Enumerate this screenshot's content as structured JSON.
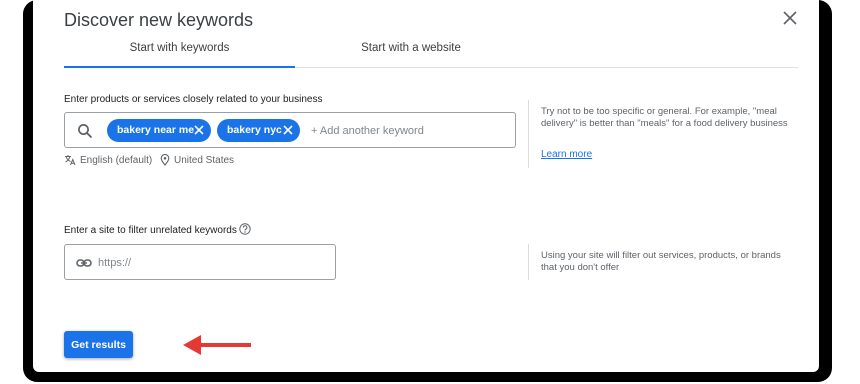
{
  "dialog": {
    "title": "Discover new keywords",
    "close_icon": "close-icon"
  },
  "tabs": [
    {
      "label": "Start with keywords",
      "active": true
    },
    {
      "label": "Start with a website",
      "active": false
    }
  ],
  "keywords_section": {
    "label": "Enter products or services closely related to your business",
    "chips": [
      {
        "label": "bakery near me"
      },
      {
        "label": "bakery nyc"
      }
    ],
    "input_placeholder": "+ Add another keyword",
    "input_value": "",
    "language": "English (default)",
    "location": "United States",
    "hint": "Try not to be too specific or general. For example, \"meal delivery\" is better than \"meals\" for a food delivery business",
    "learn_more": "Learn more"
  },
  "site_section": {
    "label": "Enter a site to filter unrelated keywords",
    "input_placeholder": "https://",
    "input_value": "",
    "hint": "Using your site will filter out services, products, or brands that you don't offer"
  },
  "actions": {
    "get_results_label": "Get results"
  },
  "colors": {
    "accent": "#1a73e8",
    "annotation_arrow": "#e53935"
  }
}
